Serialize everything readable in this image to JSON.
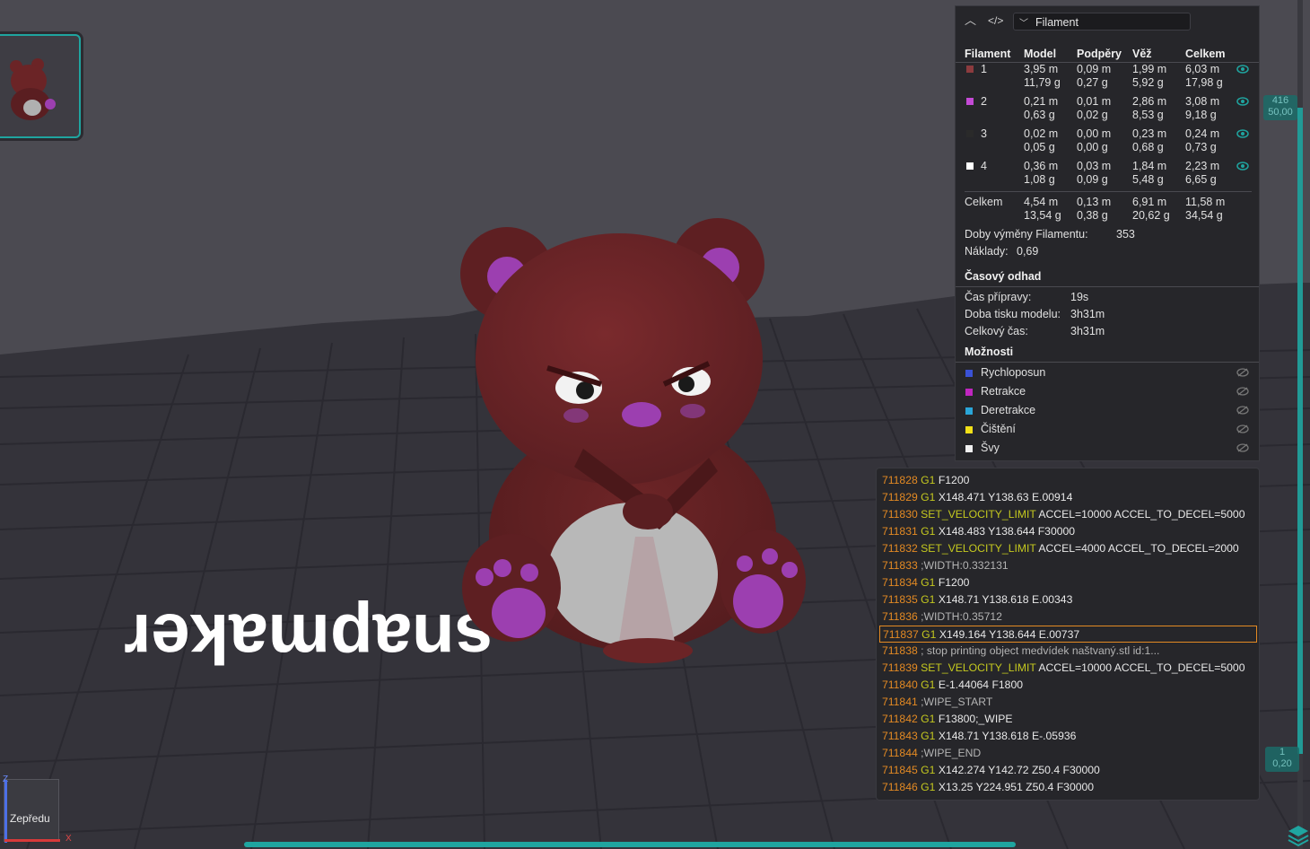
{
  "viewport": {
    "bed_text": "snapmaker",
    "colors": {
      "bear_body": "#6b2426",
      "bear_purple": "#9c3fb0",
      "bed_grid": "#2f2e35",
      "accent": "#1fa5a0"
    }
  },
  "panel": {
    "icons": [
      "collapse-icon",
      "code-icon"
    ],
    "view_select": "Filament",
    "headers": {
      "filament": "Filament",
      "model": "Model",
      "supports": "Podpěry",
      "tower": "Věž",
      "total": "Celkem"
    },
    "rows": [
      {
        "id": "1",
        "color": "#8c3b3e",
        "model": [
          "3,95 m",
          "11,79 g"
        ],
        "supports": [
          "0,09 m",
          "0,27 g"
        ],
        "tower": [
          "1,99 m",
          "5,92 g"
        ],
        "total": [
          "6,03 m",
          "17,98 g"
        ]
      },
      {
        "id": "2",
        "color": "#c44ad6",
        "model": [
          "0,21 m",
          "0,63 g"
        ],
        "supports": [
          "0,01 m",
          "0,02 g"
        ],
        "tower": [
          "2,86 m",
          "8,53 g"
        ],
        "total": [
          "3,08 m",
          "9,18 g"
        ]
      },
      {
        "id": "3",
        "color": "#2a2a2a",
        "model": [
          "0,02 m",
          "0,05 g"
        ],
        "supports": [
          "0,00 m",
          "0,00 g"
        ],
        "tower": [
          "0,23 m",
          "0,68 g"
        ],
        "total": [
          "0,24 m",
          "0,73 g"
        ]
      },
      {
        "id": "4",
        "color": "#ffffff",
        "model": [
          "0,36 m",
          "1,08 g"
        ],
        "supports": [
          "0,03 m",
          "0,09 g"
        ],
        "tower": [
          "1,84 m",
          "5,48 g"
        ],
        "total": [
          "2,23 m",
          "6,65 g"
        ]
      }
    ],
    "sum": {
      "label": "Celkem",
      "model": [
        "4,54 m",
        "13,54 g"
      ],
      "supports": [
        "0,13 m",
        "0,38 g"
      ],
      "tower": [
        "6,91 m",
        "20,62 g"
      ],
      "total": [
        "11,58 m",
        "34,54 g"
      ]
    },
    "changes": {
      "label": "Doby výměny Filamentu:",
      "value": "353"
    },
    "cost": {
      "label": "Náklady:",
      "value": "0,69"
    },
    "time": {
      "title": "Časový odhad",
      "rows": [
        {
          "label": "Čas přípravy:",
          "value": "19s"
        },
        {
          "label": "Doba tisku modelu:",
          "value": "3h31m"
        },
        {
          "label": "Celkový čas:",
          "value": "3h31m"
        }
      ]
    },
    "options": {
      "title": "Možnosti",
      "items": [
        {
          "label": "Rychloposun",
          "color": "#3a52d6"
        },
        {
          "label": "Retrakce",
          "color": "#c026c0"
        },
        {
          "label": "Deretrakce",
          "color": "#2aa6d8"
        },
        {
          "label": "Čištění",
          "color": "#f2e018"
        },
        {
          "label": "Švy",
          "color": "#f0f0f0"
        }
      ]
    }
  },
  "gcode": {
    "lines": [
      {
        "n": "711828",
        "cmd": "G1",
        "args": "F1200",
        "type": "cmd"
      },
      {
        "n": "711829",
        "cmd": "G1",
        "args": "X148.471 Y138.63 E.00914",
        "type": "cmd"
      },
      {
        "n": "711830",
        "cmd": "SET_VELOCITY_LIMIT",
        "args": "ACCEL=10000 ACCEL_TO_DECEL=5000",
        "type": "cmd"
      },
      {
        "n": "711831",
        "cmd": "G1",
        "args": "X148.483 Y138.644 F30000",
        "type": "cmd"
      },
      {
        "n": "711832",
        "cmd": "SET_VELOCITY_LIMIT",
        "args": "ACCEL=4000 ACCEL_TO_DECEL=2000",
        "type": "cmd"
      },
      {
        "n": "711833",
        "cmd": "",
        "args": ";WIDTH:0.332131",
        "type": "cmt"
      },
      {
        "n": "711834",
        "cmd": "G1",
        "args": "F1200",
        "type": "cmd"
      },
      {
        "n": "711835",
        "cmd": "G1",
        "args": "X148.71 Y138.618 E.00343",
        "type": "cmd"
      },
      {
        "n": "711836",
        "cmd": "",
        "args": ";WIDTH:0.35712",
        "type": "cmt"
      },
      {
        "n": "711837",
        "cmd": "G1",
        "args": "X149.164 Y138.644 E.00737",
        "type": "cmd",
        "current": true
      },
      {
        "n": "711838",
        "cmd": "",
        "args": "; stop printing object medvídek naštvaný.stl id:1...",
        "type": "cmt"
      },
      {
        "n": "711839",
        "cmd": "SET_VELOCITY_LIMIT",
        "args": "ACCEL=10000 ACCEL_TO_DECEL=5000",
        "type": "cmd"
      },
      {
        "n": "711840",
        "cmd": "G1",
        "args": "E-1.44064 F1800",
        "type": "cmd"
      },
      {
        "n": "711841",
        "cmd": "",
        "args": ";WIPE_START",
        "type": "cmt"
      },
      {
        "n": "711842",
        "cmd": "G1",
        "args": "F13800;_WIPE",
        "type": "cmd"
      },
      {
        "n": "711843",
        "cmd": "G1",
        "args": "X148.71 Y138.618 E-.05936",
        "type": "cmd"
      },
      {
        "n": "711844",
        "cmd": "",
        "args": ";WIPE_END",
        "type": "cmt"
      },
      {
        "n": "711845",
        "cmd": "G1",
        "args": "X142.274 Y142.72 Z50.4 F30000",
        "type": "cmd"
      },
      {
        "n": "711846",
        "cmd": "G1",
        "args": "X13.25 Y224.951 Z50.4 F30000",
        "type": "cmd"
      }
    ]
  },
  "layer_slider": {
    "top_layer": "416",
    "top_height": "50,00",
    "bottom_layer": "1",
    "bottom_height": "0,20"
  },
  "axis_cube": {
    "face_label": "Zepředu",
    "axis_x": "X",
    "axis_z": "Z"
  }
}
